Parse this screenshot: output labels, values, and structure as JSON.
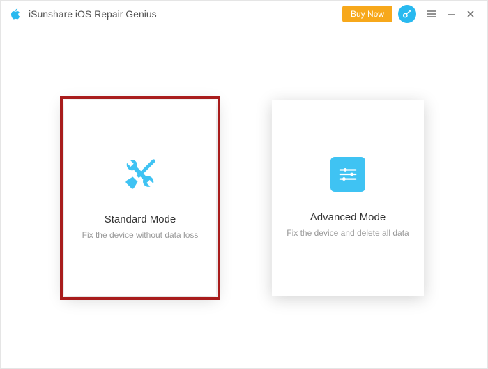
{
  "app": {
    "title": "iSunshare iOS Repair Genius",
    "buy_label": "Buy Now"
  },
  "cards": {
    "standard": {
      "title": "Standard Mode",
      "subtitle": "Fix the device without data loss"
    },
    "advanced": {
      "title": "Advanced Mode",
      "subtitle": "Fix the device and delete all data"
    }
  }
}
